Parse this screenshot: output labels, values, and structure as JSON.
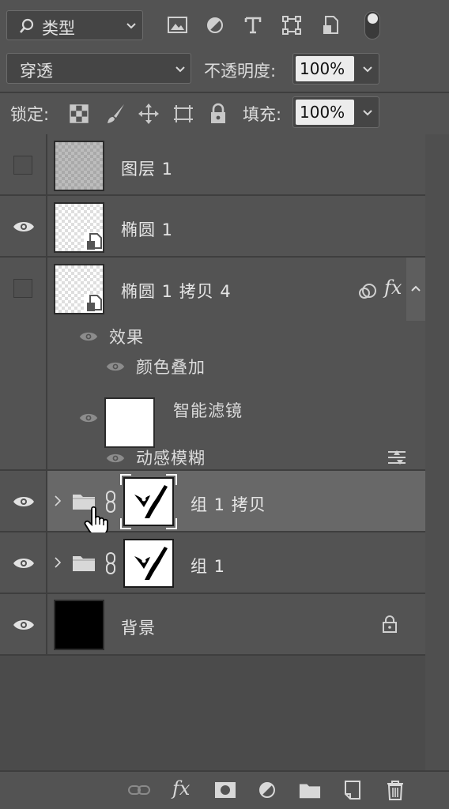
{
  "filter": {
    "search_icon": "search-icon",
    "kind_label": "类型",
    "filter_icons": [
      "image-filter-icon",
      "adjustment-filter-icon",
      "type-filter-icon",
      "shape-filter-icon",
      "smart-object-filter-icon"
    ]
  },
  "blend": {
    "mode": "穿透",
    "opacity_label": "不透明度:",
    "opacity_value": "100%"
  },
  "lock": {
    "label": "锁定:",
    "fill_label": "填充:",
    "fill_value": "100%"
  },
  "layers": [
    {
      "name": "图层 1",
      "visible": false,
      "type": "pixel"
    },
    {
      "name": "椭圆 1",
      "visible": true,
      "type": "smart"
    },
    {
      "name": "椭圆 1 拷贝 4",
      "visible": false,
      "type": "smart",
      "effects": {
        "label": "效果",
        "items": [
          "颜色叠加"
        ],
        "smart_filter_label": "智能滤镜",
        "filters": [
          "动感模糊"
        ]
      }
    },
    {
      "name": "组 1 拷贝",
      "visible": true,
      "type": "group",
      "selected": true
    },
    {
      "name": "组 1",
      "visible": true,
      "type": "group"
    },
    {
      "name": "背景",
      "visible": true,
      "type": "background",
      "locked": true
    }
  ],
  "fx_label": "fx",
  "colors": {
    "panel": "#535353",
    "selected_row": "#686868",
    "field_bg": "#ececec"
  },
  "bottom_icons": [
    "link-layers-icon",
    "fx-icon",
    "mask-icon",
    "adjustment-icon",
    "new-group-icon",
    "new-layer-icon",
    "delete-icon"
  ]
}
